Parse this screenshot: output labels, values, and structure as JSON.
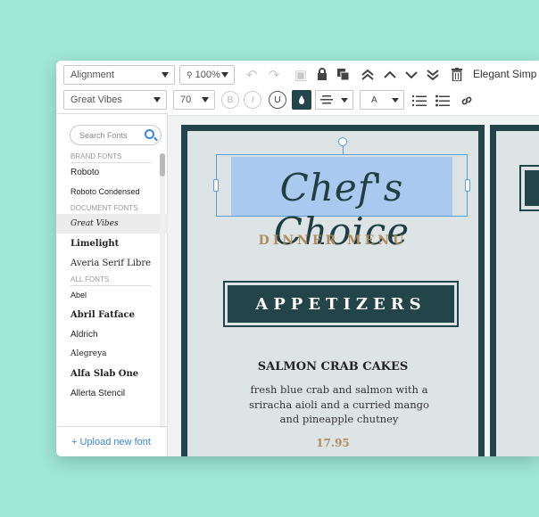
{
  "toolbar": {
    "alignment": "Alignment",
    "zoom": "100%",
    "font_family": "Great Vibes",
    "font_size": "70",
    "bold": "B",
    "italic": "I",
    "underline": "U",
    "case_glyph": "A",
    "title_text": "Elegant Simp",
    "icons": [
      "undo-icon",
      "redo-icon",
      "frame-icon",
      "lock-icon",
      "copy-icon",
      "bring-to-front-icon",
      "bring-forward-icon",
      "send-backward-icon",
      "send-to-back-icon",
      "trash-icon",
      "fill-color-icon",
      "align-icon",
      "text-case-icon",
      "numbered-list-icon",
      "bullet-list-icon",
      "link-icon"
    ]
  },
  "font_panel": {
    "search_placeholder": "Search Fonts",
    "sections": {
      "brand": "BRAND FONTS",
      "document": "DOCUMENT FONTS",
      "all": "ALL FONTS"
    },
    "brand_fonts": [
      "Roboto",
      "Roboto Condensed"
    ],
    "document_fonts": [
      "Great Vibes",
      "Limelight",
      "Averia Serif Libre"
    ],
    "all_fonts": [
      "Abel",
      "Abril Fatface",
      "Aldrich",
      "Alegreya",
      "Alfa Slab One",
      "Allerta Stencil"
    ],
    "upload": "+ Upload new font"
  },
  "menu": {
    "title": "Chef's Choice",
    "subtitle": "DINNER MENU",
    "section": "APPETIZERS",
    "dish": "SALMON CRAB CAKES",
    "description": "fresh blue crab and salmon with a sriracha aioli and a curried mango and pineapple chutney",
    "price": "17.95"
  },
  "colors": {
    "background": "#9ee6d5",
    "menu_dark": "#234549",
    "menu_gold": "#b08c5e",
    "selection": "#a9c9ee",
    "accent": "#3a87d6"
  }
}
